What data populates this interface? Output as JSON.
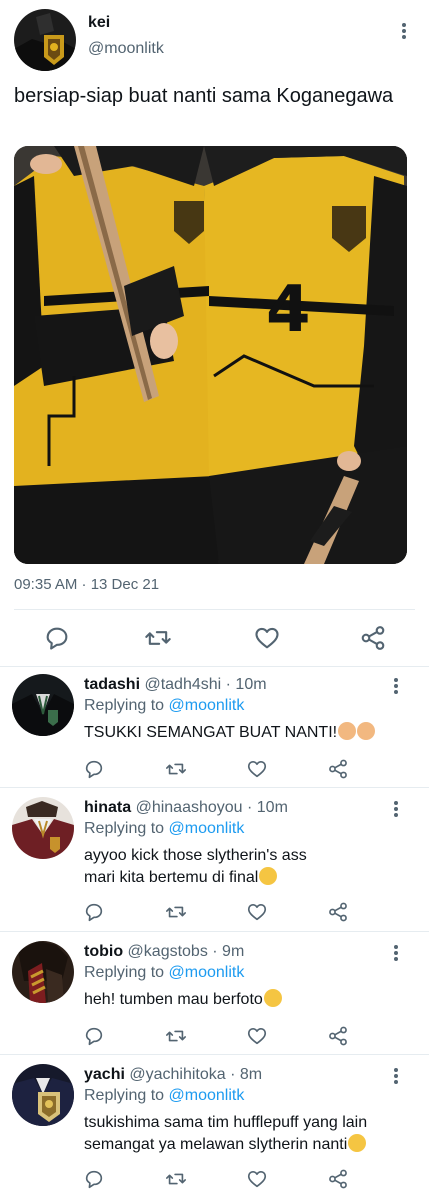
{
  "tweet": {
    "name": "kei",
    "handle": "@moonlitk",
    "text": "bersiap-siap buat nanti sama Koganegawa",
    "photo_jersey_number": "4",
    "timestamp": "09:35 AM · 13 Dec 21"
  },
  "icons": {
    "more": "more-vertical-icon",
    "reply": "reply-icon",
    "retweet": "retweet-icon",
    "like": "heart-icon",
    "share": "share-icon"
  },
  "colors": {
    "link": "#1d9bf0",
    "secondary_text": "#536471",
    "jersey_yellow": "#e3b21f"
  },
  "replies": [
    {
      "name": "tadashi",
      "meta": "@tadh4shi · 10m",
      "replying_prefix": "Replying to",
      "replying_to": "@moonlitk",
      "text": "TSUKKI SEMANGAT BUAT NANTI!",
      "emoji": [
        "flexed-biceps-emoji",
        "flexed-biceps-emoji"
      ]
    },
    {
      "name": "hinata",
      "meta": "@hinaashoyou · 10m",
      "replying_prefix": "Replying to",
      "replying_to": "@moonlitk",
      "text_line1": "ayyoo kick those slytherin's ass",
      "text_line2": "mari kita bertemu di final",
      "emoji": [
        "relieved-face-emoji"
      ]
    },
    {
      "name": "tobio",
      "meta": "@kagstobs · 9m",
      "replying_prefix": "Replying to",
      "replying_to": "@moonlitk",
      "text": "heh! tumben mau berfoto",
      "emoji": [
        "rolling-eyes-emoji"
      ]
    },
    {
      "name": "yachi",
      "meta": "@yachihitoka · 8m",
      "replying_prefix": "Replying to",
      "replying_to": "@moonlitk",
      "text_line1": "tsukishima sama tim hufflepuff yang lain",
      "text_line2": "semangat ya melawan slytherin nanti",
      "emoji": [
        "grimacing-face-emoji"
      ]
    }
  ]
}
